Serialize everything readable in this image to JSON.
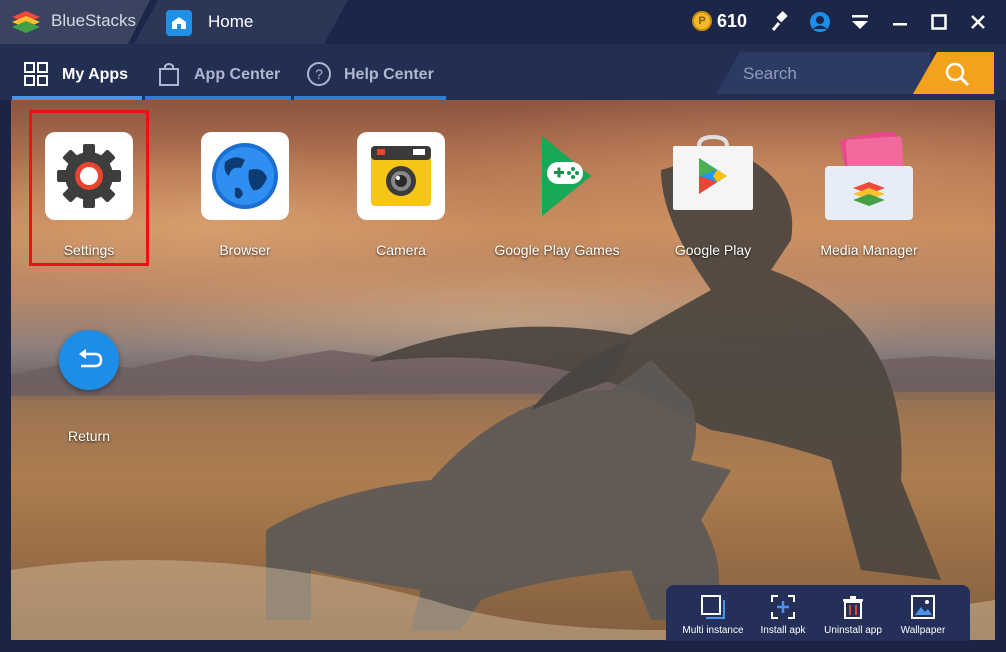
{
  "titlebar": {
    "brand": "BlueStacks",
    "tab": "Home",
    "coins": "610"
  },
  "nav": {
    "tabs": [
      {
        "label": "My Apps"
      },
      {
        "label": "App Center"
      },
      {
        "label": "Help Center"
      }
    ]
  },
  "search": {
    "placeholder": "Search"
  },
  "apps": [
    {
      "label": "Settings"
    },
    {
      "label": "Browser"
    },
    {
      "label": "Camera"
    },
    {
      "label": "Google Play Games"
    },
    {
      "label": "Google Play"
    },
    {
      "label": "Media Manager"
    }
  ],
  "return_label": "Return",
  "toolbar": {
    "items": [
      {
        "label": "Multi instance"
      },
      {
        "label": "Install apk"
      },
      {
        "label": "Uninstall app"
      },
      {
        "label": "Wallpaper"
      }
    ]
  },
  "colors": {
    "accent": "#1e8de8",
    "search_button": "#f4a21b",
    "selection": "#ee1111"
  }
}
